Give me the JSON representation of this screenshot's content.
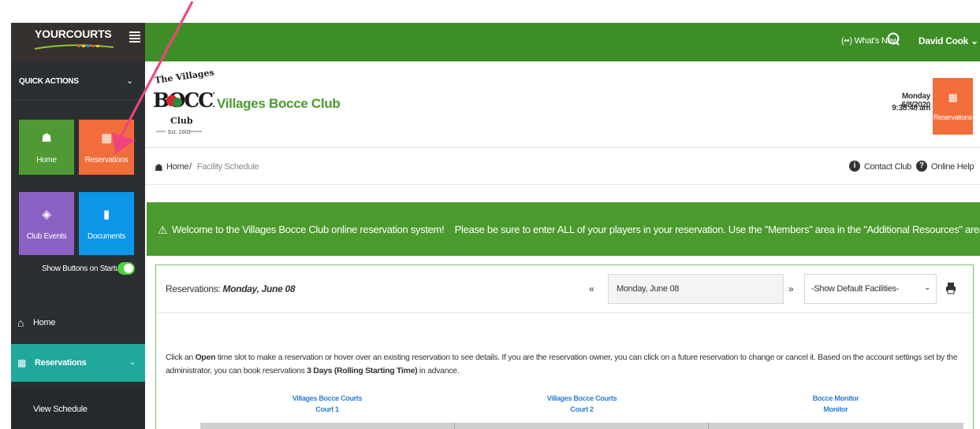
{
  "app": {
    "logo_text": "YOURCOURTS",
    "accent_color": "#3e8e28",
    "orange_color": "#f26d3c"
  },
  "topbar": {
    "whats_new": "(••) What's New",
    "user_name": "David Cook ⌄"
  },
  "sidebar": {
    "quick_actions_label": "QUICK ACTIONS",
    "buttons": [
      {
        "label": "Home",
        "icon": "home-icon"
      },
      {
        "label": "Reservations",
        "icon": "calendar-icon"
      },
      {
        "label": "Club Events",
        "icon": "ticket-icon"
      },
      {
        "label": "Documents",
        "icon": "document-icon"
      }
    ],
    "show_buttons_label": "Show Buttons on Startup",
    "show_buttons_on": true,
    "nav": {
      "home": "Home",
      "reservations": "Reservations",
      "view_schedule": "View Schedule"
    }
  },
  "club": {
    "name": "Villages Bocce Club",
    "logo": {
      "line1": "The Villages",
      "line2": "BOCCE",
      "line3": "Club",
      "line4": "Est. 2002"
    },
    "date": "Monday 6/8/2020",
    "time": "9:38:48 am",
    "reservations_button": "Reservations"
  },
  "breadcrumb": {
    "home": "Home",
    "separator": "/",
    "current": "Facility Schedule",
    "contact": "Contact Club",
    "help": "Online Help"
  },
  "banner": {
    "text": "Welcome to the Villages Bocce Club online reservation system!    Please be sure to enter ALL of your players in your reservation. Use the \"Members\" area in the \"Additional Resources\" area."
  },
  "reservations": {
    "title_prefix": "Reservations: ",
    "title_date": "Monday, June 08",
    "date_input": "Monday, June 08",
    "facilities_select": "-Show Default Facilities-",
    "instructions_1": "Click an ",
    "instructions_open": "Open",
    "instructions_2": " time slot to make a reservation or hover over an existing reservation to see details. If you are the reservation owner, you can click on a future reservation to change or cancel it. Based on the account settings set by the administrator, you can book reservations ",
    "instructions_bold": "3 Days (Rolling Starting Time)",
    "instructions_3": " in advance.",
    "courts": [
      {
        "group": "Villages Bocce Courts",
        "name": "Court 1"
      },
      {
        "group": "Villages Bocce Courts",
        "name": "Court 2"
      },
      {
        "group": "Bocce Monitor",
        "name": "Monitor"
      }
    ]
  }
}
